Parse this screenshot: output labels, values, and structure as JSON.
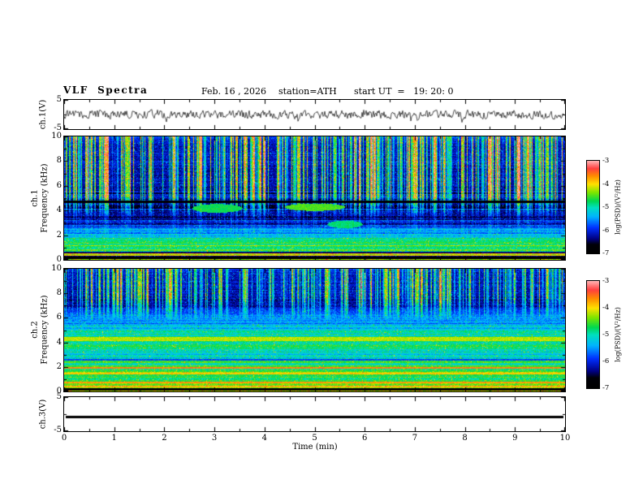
{
  "header": {
    "title": "VLF  Spectra",
    "date": "Feb. 16 , 2026",
    "station": "station=ATH",
    "start_ut": "start UT  =   19: 20: 0"
  },
  "axes": {
    "time_label": "Time  (min)",
    "x_ticks": [
      "0",
      "1",
      "2",
      "3",
      "4",
      "5",
      "6",
      "7",
      "8",
      "9",
      "10"
    ],
    "wave_label": "ch.1(V)",
    "wave_yticks": [
      "5",
      "-5"
    ],
    "spec1_label_ch": "ch.1",
    "spec2_label_ch": "ch.2",
    "spec_freq_label": "Frequency (kHz)",
    "spec_yticks_desc": [
      "10",
      "8",
      "6",
      "4",
      "2",
      "0"
    ],
    "ch3_label": "ch.3(V)",
    "ch3_yticks": [
      "5",
      "-5"
    ]
  },
  "colorbar": {
    "label": "log(PSD)/(V²/Hz)",
    "ticks": [
      "-3",
      "-4",
      "-5",
      "-6",
      "-7"
    ],
    "vmax": -3,
    "vmin": -7
  },
  "style": {
    "background": "#ffffff",
    "axis_color": "#000000",
    "trace_color": "#000000",
    "colormap_stops": [
      [
        0.0,
        "#000000"
      ],
      [
        0.1,
        "#000008"
      ],
      [
        0.16,
        "#000080"
      ],
      [
        0.28,
        "#0030ff"
      ],
      [
        0.4,
        "#00b4ff"
      ],
      [
        0.5,
        "#00e0c0"
      ],
      [
        0.57,
        "#00d850"
      ],
      [
        0.66,
        "#7ce600"
      ],
      [
        0.75,
        "#ffe100"
      ],
      [
        0.84,
        "#ff8c00"
      ],
      [
        0.92,
        "#ff4040"
      ],
      [
        1.0,
        "#ffb0b0"
      ]
    ]
  },
  "chart_data": [
    {
      "id": "wave",
      "type": "line",
      "label": "ch.1(V) time series",
      "xlim": [
        0,
        10
      ],
      "ylim": [
        -5,
        5
      ],
      "seed": 11,
      "description": "broadband noisy voltage trace centered near 0 V, typical excursions ±1.5 V with sporadic spikes to ±3.5 V"
    },
    {
      "id": "spec1",
      "type": "heatmap",
      "label": "ch.1 spectrogram",
      "xlabel": "Time (min)",
      "ylabel": "Frequency (kHz)",
      "xlim": [
        0,
        10
      ],
      "ylim": [
        0,
        10
      ],
      "zlim": [
        -7,
        -3
      ],
      "seed": 42,
      "streak_onset_khz": 3.6,
      "sub_streak": true,
      "freq_profile": [
        [
          0.0,
          -4.3
        ],
        [
          0.08,
          -4.3
        ],
        [
          0.12,
          -7.0
        ],
        [
          0.32,
          -7.0
        ],
        [
          0.38,
          -3.9
        ],
        [
          0.52,
          -4.0
        ],
        [
          0.6,
          -5.2
        ],
        [
          0.72,
          -4.7
        ],
        [
          1.2,
          -4.7
        ],
        [
          1.8,
          -5.0
        ],
        [
          2.4,
          -5.6
        ],
        [
          3.0,
          -6.05
        ],
        [
          3.6,
          -6.3
        ],
        [
          5.0,
          -6.3
        ],
        [
          7.0,
          -6.2
        ],
        [
          9.5,
          -6.1
        ],
        [
          10.0,
          -5.9
        ]
      ],
      "lines": [
        {
          "f": 4.75,
          "v": -6.8,
          "w": 0.12
        },
        {
          "f": 0.62,
          "v": -6.4,
          "w": 0.08
        }
      ],
      "blobs": [
        {
          "x": 3.05,
          "f": 4.2,
          "rx": 0.5,
          "rf": 0.35,
          "v": -4.7
        },
        {
          "x": 5.0,
          "f": 4.3,
          "rx": 0.6,
          "rf": 0.3,
          "v": -4.5
        },
        {
          "x": 5.6,
          "f": 2.9,
          "rx": 0.35,
          "rf": 0.3,
          "v": -4.8
        }
      ],
      "description": "dense vertical sferic streaks (green/cyan, ~-4.8) on dark blue background (~-6.3) above 4 kHz; striated blue/cyan 2-5 kHz; green/yellow bands below 2 kHz; black band near 0.2 kHz; bright band ~0.4 kHz"
    },
    {
      "id": "spec2",
      "type": "heatmap",
      "label": "ch.2 spectrogram",
      "xlabel": "Time (min)",
      "ylabel": "Frequency (kHz)",
      "xlim": [
        0,
        10
      ],
      "ylim": [
        0,
        10
      ],
      "zlim": [
        -7,
        -3
      ],
      "seed": 99,
      "streak_onset_khz": 5.8,
      "sub_streak": false,
      "freq_profile": [
        [
          0.0,
          -4.1
        ],
        [
          0.08,
          -4.1
        ],
        [
          0.12,
          -7.0
        ],
        [
          0.28,
          -7.0
        ],
        [
          0.34,
          -3.8
        ],
        [
          0.5,
          -4.1
        ],
        [
          0.7,
          -4.4
        ],
        [
          1.0,
          -4.5
        ],
        [
          2.2,
          -4.7
        ],
        [
          2.8,
          -5.1
        ],
        [
          3.4,
          -5.0
        ],
        [
          4.1,
          -4.9
        ],
        [
          4.4,
          -4.6
        ],
        [
          4.7,
          -5.1
        ],
        [
          5.2,
          -5.3
        ],
        [
          6.2,
          -5.6
        ],
        [
          7.0,
          -6.25
        ],
        [
          9.5,
          -6.15
        ],
        [
          10.0,
          -6.0
        ]
      ],
      "lines": [
        {
          "f": 0.75,
          "v": -3.7,
          "w": 0.1
        },
        {
          "f": 1.5,
          "v": -3.9,
          "w": 0.1
        },
        {
          "f": 1.95,
          "v": -3.6,
          "w": 0.12
        },
        {
          "f": 2.6,
          "v": -5.8,
          "w": 0.08
        },
        {
          "f": 4.3,
          "v": -4.2,
          "w": 0.25
        }
      ],
      "blobs": [],
      "description": "green/yellow horizontal banding below ~5 kHz with narrow orange lines near 0.75, 1.5, 1.95 kHz; cyan 5-6.5 kHz; dark blue with dense sferic streaks 6.5-10 kHz; black band near 0.2 kHz"
    },
    {
      "id": "ch3",
      "type": "line",
      "label": "ch.3(V) time series",
      "xlim": [
        0,
        10
      ],
      "ylim": [
        -5,
        5
      ],
      "constant_value": -0.8,
      "description": "flat constant thick trace — channel silent"
    }
  ]
}
